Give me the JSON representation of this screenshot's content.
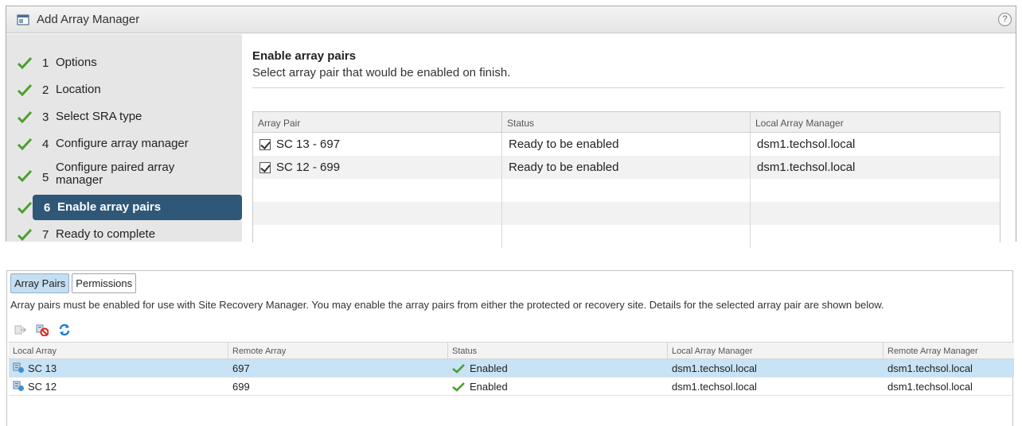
{
  "wizard": {
    "title": "Add Array Manager",
    "help": "?",
    "steps": [
      {
        "num": "1",
        "label": "Options",
        "done": true
      },
      {
        "num": "2",
        "label": "Location",
        "done": true
      },
      {
        "num": "3",
        "label": "Select SRA type",
        "done": true
      },
      {
        "num": "4",
        "label": "Configure array manager",
        "done": true
      },
      {
        "num": "5",
        "label": "Configure paired array manager",
        "done": true
      },
      {
        "num": "6",
        "label": "Enable array pairs",
        "done": true,
        "active": true
      },
      {
        "num": "7",
        "label": "Ready to complete",
        "done": true
      }
    ],
    "content": {
      "heading": "Enable array pairs",
      "subheading": "Select array pair that would be enabled on finish.",
      "columns": [
        "Array Pair",
        "Status",
        "Local Array Manager"
      ],
      "rows": [
        {
          "pair": "SC 13 - 697",
          "checked": true,
          "status": "Ready to be enabled",
          "manager": "dsm1.techsol.local"
        },
        {
          "pair": "SC 12 - 699",
          "checked": true,
          "status": "Ready to be enabled",
          "manager": "dsm1.techsol.local"
        }
      ]
    }
  },
  "bottom": {
    "tabs": [
      "Array Pairs",
      "Permissions"
    ],
    "active_tab": "Array Pairs",
    "description": "Array pairs must be enabled for use with Site Recovery Manager. You may enable the array pairs from either the protected or recovery site. Details for the selected array pair are shown below.",
    "toolbar": [
      "enable-pair-icon",
      "disable-pair-icon",
      "refresh-icon"
    ],
    "columns": [
      "Local Array",
      "Remote Array",
      "Status",
      "Local Array Manager",
      "Remote Array Manager"
    ],
    "rows": [
      {
        "local": "SC 13",
        "remote": "697",
        "status": "Enabled",
        "local_mgr": "dsm1.techsol.local",
        "remote_mgr": "dsm1.techsol.local",
        "selected": true
      },
      {
        "local": "SC 12",
        "remote": "699",
        "status": "Enabled",
        "local_mgr": "dsm1.techsol.local",
        "remote_mgr": "dsm1.techsol.local",
        "selected": false
      }
    ]
  },
  "colors": {
    "active_step": "#2e5778",
    "check_green": "#4aa02c",
    "selected_row": "#c7e3f5",
    "active_tab": "#c5def2"
  }
}
